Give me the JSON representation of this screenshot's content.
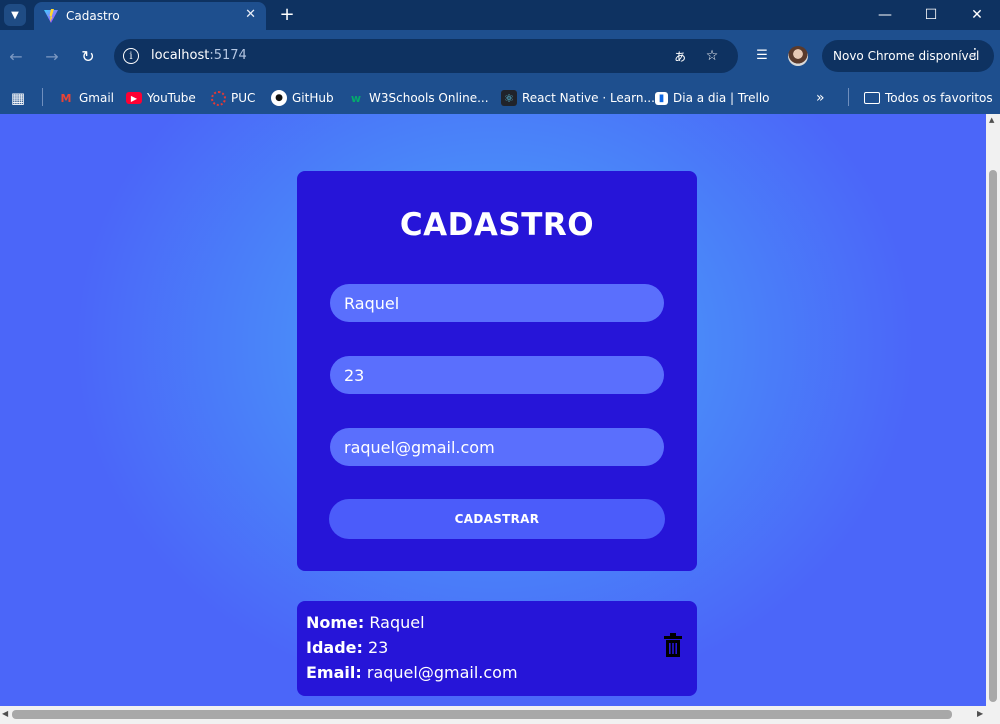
{
  "browser": {
    "tab_title": "Cadastro",
    "url_host": "localhost",
    "url_port": ":5174",
    "update_label": "Novo Chrome disponível",
    "bookmarks": [
      {
        "label": "Gmail",
        "icon": "gmail-icon"
      },
      {
        "label": "YouTube",
        "icon": "youtube-icon"
      },
      {
        "label": "PUC",
        "icon": "puc-icon"
      },
      {
        "label": "GitHub",
        "icon": "github-icon"
      },
      {
        "label": "W3Schools Online...",
        "icon": "w3schools-icon"
      },
      {
        "label": "React Native · Learn...",
        "icon": "react-icon"
      },
      {
        "label": "Dia a dia | Trello",
        "icon": "trello-icon"
      }
    ],
    "all_bookmarks_label": "Todos os favoritos"
  },
  "form": {
    "title": "CADASTRO",
    "name_value": "Raquel",
    "age_value": "23",
    "email_value": "raquel@gmail.com",
    "submit_label": "CADASTRAR"
  },
  "result": {
    "name_label": "Nome:",
    "name_value": "Raquel",
    "age_label": "Idade:",
    "age_value": "23",
    "email_label": "Email:",
    "email_value": "raquel@gmail.com"
  },
  "colors": {
    "card": "#2615d8",
    "field": "#5a6ffd",
    "button": "#4b5cfa",
    "page_gradient_center": "#4a9cf7",
    "page_gradient_edge": "#4b66f9"
  }
}
